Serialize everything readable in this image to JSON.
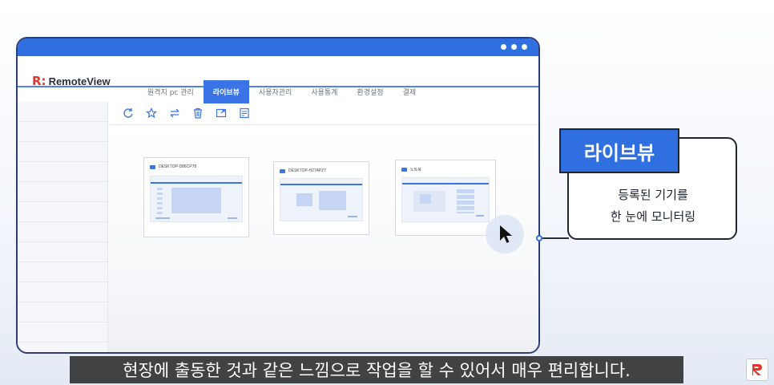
{
  "window": {
    "dots": [
      "dot",
      "dot",
      "dot"
    ]
  },
  "app": {
    "logo_mark": "R:",
    "logo_text": "RemoteView"
  },
  "tabs": [
    {
      "label": "원격지 pc 관리",
      "active": false
    },
    {
      "label": "라이브뷰",
      "active": true
    },
    {
      "label": "사용자관리",
      "active": false
    },
    {
      "label": "사용통계",
      "active": false
    },
    {
      "label": "환경설정",
      "active": false
    },
    {
      "label": "결제",
      "active": false
    }
  ],
  "toolbar": {
    "icons": [
      "refresh-icon",
      "star-icon",
      "swap-icon",
      "delete-icon",
      "expand-icon",
      "memo-icon"
    ]
  },
  "devices": [
    {
      "name": "DESKTOP-D86CP78"
    },
    {
      "name": "DESKTOP-H27AP27"
    },
    {
      "name": "노트북"
    }
  ],
  "callout": {
    "title": "라이브뷰",
    "line1": "등록된 기기를",
    "line2": "한 눈에 모니터링"
  },
  "subtitle": "현장에 출동한 것과 같은 느낌으로 작업을 할 수 있어서 매우 편리합니다.",
  "colors": {
    "accent": "#2f6fe0",
    "logo_red": "#e8332a",
    "frame": "#2c3e7a"
  }
}
